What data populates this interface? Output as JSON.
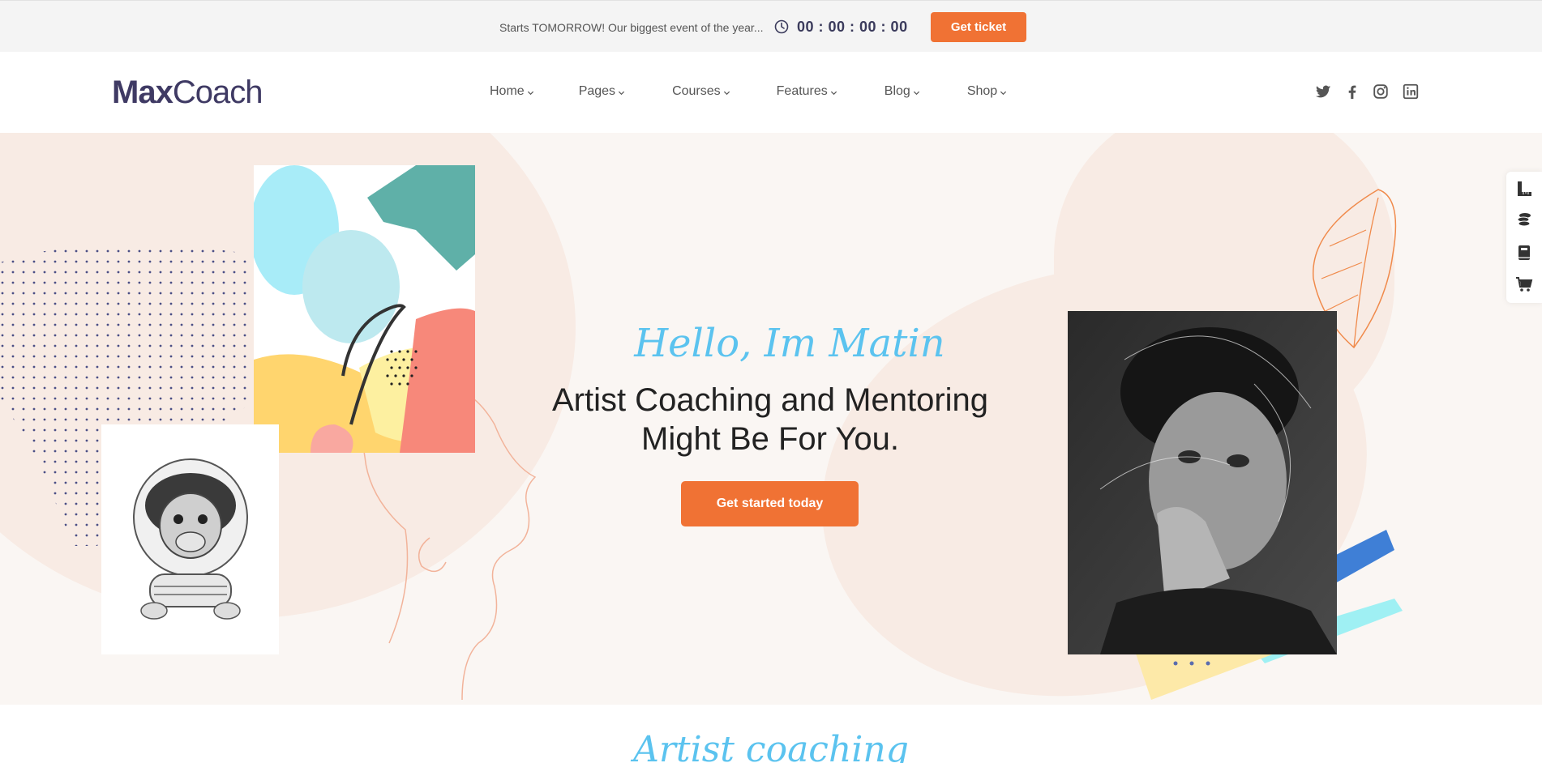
{
  "topbar": {
    "announcement": "Starts TOMORROW! Our biggest event of the year...",
    "countdown": "00 : 00 : 00 : 00",
    "ticket_label": "Get ticket"
  },
  "header": {
    "logo_bold": "Max",
    "logo_light": "Coach",
    "nav": [
      {
        "label": "Home"
      },
      {
        "label": "Pages"
      },
      {
        "label": "Courses"
      },
      {
        "label": "Features"
      },
      {
        "label": "Blog"
      },
      {
        "label": "Shop"
      }
    ],
    "social_icons": [
      "twitter-icon",
      "facebook-icon",
      "instagram-icon",
      "linkedin-icon"
    ]
  },
  "hero": {
    "greeting": "Hello, Im Matin",
    "title_line1": "Artist Coaching and Mentoring",
    "title_line2": "Might Be For You.",
    "cta_label": "Get started today"
  },
  "sidebar_icons": [
    "ruler-icon",
    "coins-icon",
    "book-icon",
    "cart-icon"
  ],
  "section": {
    "title": "Artist coaching"
  },
  "colors": {
    "accent": "#f07234",
    "brand": "#3f3a64",
    "script_blue": "#5bc3ef",
    "hero_bg": "#faf6f3",
    "blob": "#f8ebe4"
  }
}
